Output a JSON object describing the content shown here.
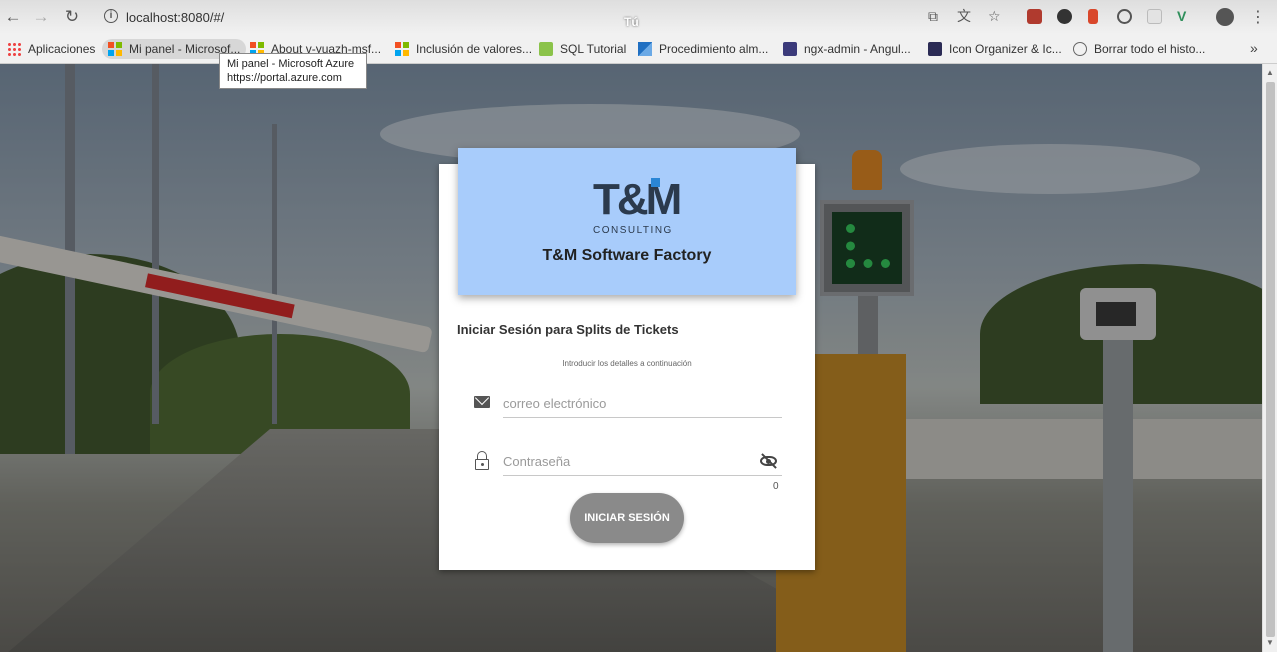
{
  "browser": {
    "url": "localhost:8080/#/",
    "profile_label": "Tú",
    "bookmarks": [
      {
        "label": "Aplicaciones"
      },
      {
        "label": "Mi panel - Microsof..."
      },
      {
        "label": "About v-yuazh-msf..."
      },
      {
        "label": "Inclusión de valores..."
      },
      {
        "label": "SQL Tutorial"
      },
      {
        "label": "Procedimiento alm..."
      },
      {
        "label": "ngx-admin - Angul..."
      },
      {
        "label": "Icon Organizer & Ic..."
      },
      {
        "label": "Borrar todo el histo..."
      }
    ],
    "tooltip": {
      "title": "Mi panel - Microsoft Azure",
      "url": "https://portal.azure.com"
    }
  },
  "brand": {
    "logo_text": "T&M",
    "logo_sub": "CONSULTING",
    "name": "T&M Software Factory",
    "header_color": "#a8ccfb"
  },
  "login": {
    "title": "Iniciar Sesión para Splits de Tickets",
    "subtitle": "Introducir los detalles a continuación",
    "email_placeholder": "correo electrónico",
    "password_placeholder": "Contraseña",
    "password_counter": "0",
    "submit_label": "INICIAR SESIÓN"
  }
}
